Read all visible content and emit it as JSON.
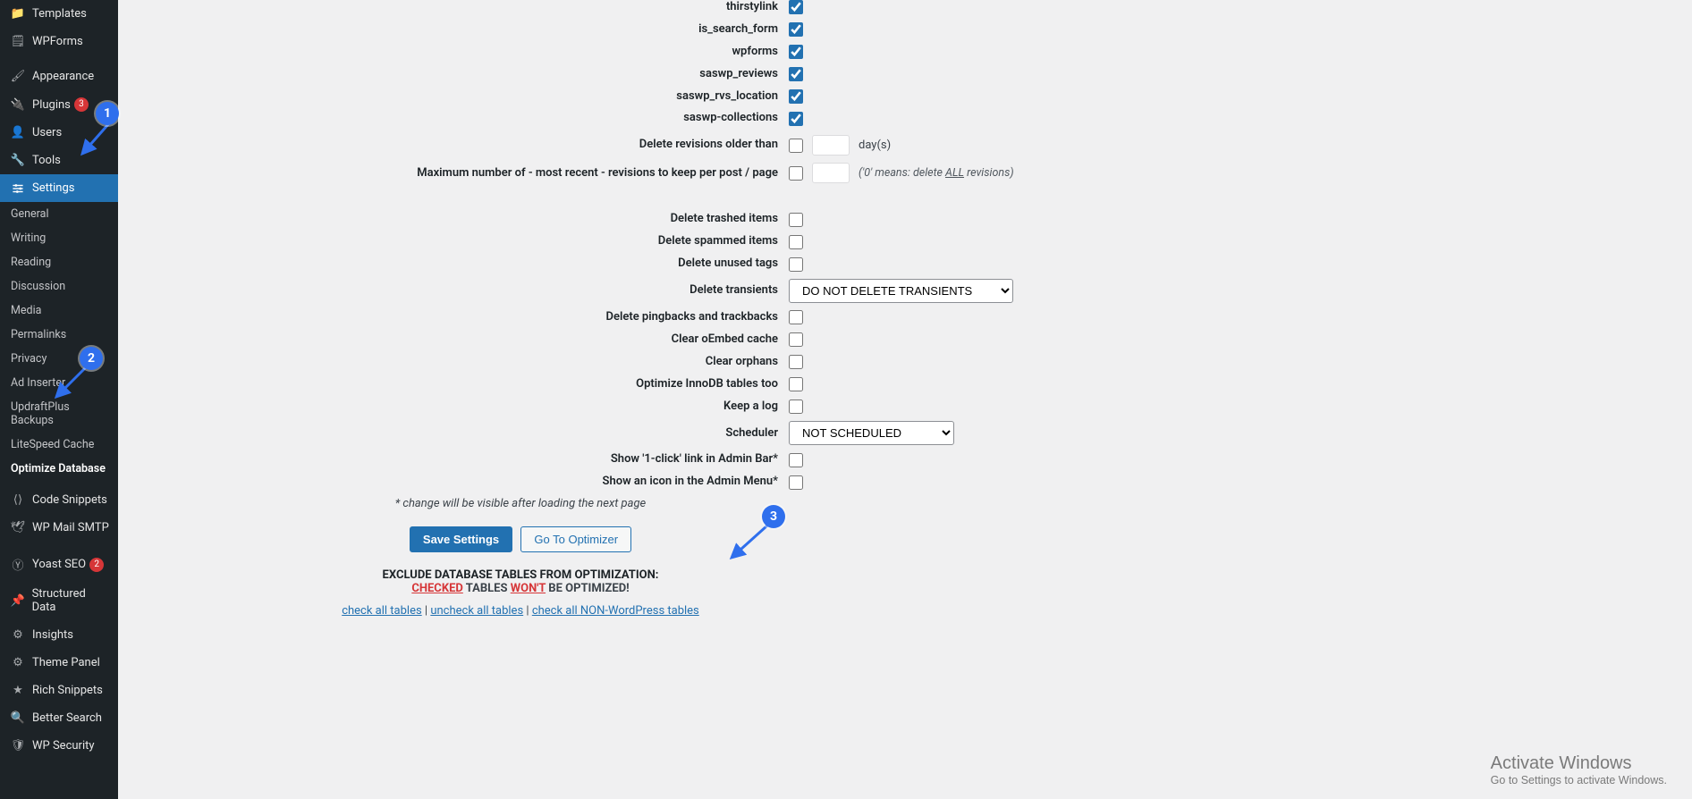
{
  "sidebar": {
    "templates": "Templates",
    "wpforms": "WPForms",
    "appearance": "Appearance",
    "plugins": "Plugins",
    "plugins_badge": "3",
    "users": "Users",
    "tools": "Tools",
    "settings": "Settings",
    "sub": {
      "general": "General",
      "writing": "Writing",
      "reading": "Reading",
      "discussion": "Discussion",
      "media": "Media",
      "permalinks": "Permalinks",
      "privacy": "Privacy",
      "adinserter": "Ad Inserter",
      "updraft": "UpdraftPlus Backups",
      "litespeed": "LiteSpeed Cache",
      "optimize": "Optimize Database"
    },
    "code_snippets": "Code Snippets",
    "wp_mail": "WP Mail SMTP",
    "yoast": "Yoast SEO",
    "yoast_badge": "2",
    "structured": "Structured Data",
    "insights": "Insights",
    "theme_panel": "Theme Panel",
    "rich_snippets": "Rich Snippets",
    "better_search": "Better Search",
    "wp_security": "WP Security"
  },
  "form": {
    "checks": {
      "thirstylink": "thirstylink",
      "is_search_form": "is_search_form",
      "wpforms": "wpforms",
      "saswp_reviews": "saswp_reviews",
      "saswp_rvs_location": "saswp_rvs_location",
      "saswp_collections": "saswp-collections"
    },
    "delete_rev_label": "Delete revisions older than",
    "delete_rev_days": "day(s)",
    "max_rev_label": "Maximum number of - most recent - revisions to keep per post / page",
    "max_rev_hint_prefix": "('0' means: delete ",
    "max_rev_hint_u": "ALL",
    "max_rev_hint_suffix": " revisions)",
    "delete_trashed": "Delete trashed items",
    "delete_spammed": "Delete spammed items",
    "delete_unused_tags": "Delete unused tags",
    "delete_transients": "Delete transients",
    "transients_select": "DO NOT DELETE TRANSIENTS",
    "delete_pingbacks": "Delete pingbacks and trackbacks",
    "clear_oembed": "Clear oEmbed cache",
    "clear_orphans": "Clear orphans",
    "optimize_innodb": "Optimize InnoDB tables too",
    "keep_log": "Keep a log",
    "scheduler": "Scheduler",
    "scheduler_select": "NOT SCHEDULED",
    "show_1click": "Show '1-click' link in Admin Bar*",
    "show_icon": "Show an icon in the Admin Menu*",
    "note": "* change will be visible after loading the next page"
  },
  "buttons": {
    "save": "Save Settings",
    "goto": "Go To Optimizer"
  },
  "exclude": {
    "heading": "EXCLUDE DATABASE TABLES FROM OPTIMIZATION:",
    "checked": "CHECKED",
    "tables": " TABLES ",
    "wont": "WON'T",
    "suffix": " BE OPTIMIZED!",
    "check_all": "check all tables",
    "uncheck_all": "uncheck all tables",
    "check_nonwp": "check all NON-WordPress tables"
  },
  "watermark": {
    "line1": "Activate Windows",
    "line2": "Go to Settings to activate Windows."
  },
  "annotations": {
    "a1": "1",
    "a2": "2",
    "a3": "3"
  }
}
